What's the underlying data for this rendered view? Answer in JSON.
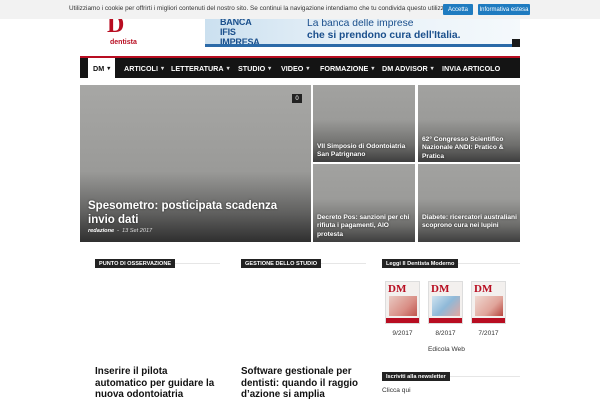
{
  "cookie": {
    "text": "Utilizziamo i cookie per offrirti i migliori contenuti del nostro sito. Se continui la navigazione intendiamo che tu condivida questo utilizzo.",
    "accept_label": "Accetta",
    "info_label": "Informativa estesa"
  },
  "header": {
    "logo_letter": "D",
    "logo_word": "dentista",
    "banner": {
      "brand_line1": "BANCA IFIS",
      "brand_line2": "IMPRESA",
      "line1": "La banca delle imprese",
      "line2": "che si prendono cura dell'Italia."
    }
  },
  "nav": {
    "items": [
      {
        "label": "DM",
        "chevron": "▾"
      },
      {
        "label": "ARTICOLI",
        "chevron": "▾"
      },
      {
        "label": "LETTERATURA",
        "chevron": "▾"
      },
      {
        "label": "STUDIO",
        "chevron": "▾"
      },
      {
        "label": "VIDEO",
        "chevron": "▾"
      },
      {
        "label": "FORMAZIONE",
        "chevron": "▾"
      },
      {
        "label": "DM ADVISOR",
        "chevron": "▾"
      },
      {
        "label": "INVIA ARTICOLO",
        "chevron": ""
      }
    ]
  },
  "hero": {
    "main": {
      "title": "Spesometro: posticipata scadenza invio dati",
      "author": "redazione",
      "separator": "-",
      "date": "13 Set 2017",
      "comments": "0"
    },
    "tiles": [
      {
        "title": "VII Simposio di Odontoiatria San Patrignano"
      },
      {
        "title": "62° Congresso Scientifico Nazionale ANDI: Pratico & Pratica"
      },
      {
        "title": "Decreto Pos: sanzioni per chi rifiuta i pagamenti, AIO protesta"
      },
      {
        "title": "Diabete: ricercatori australiani scoprono cura nei lupini"
      }
    ]
  },
  "columns": [
    {
      "category": "PUNTO DI OSSERVAZIONE",
      "title": "Inserire il pilota automatico per guidare la nuova odontoiatria"
    },
    {
      "category": "GESTIONE DELLO STUDIO",
      "title": "Software gestionale per dentisti: quando il raggio d’azione si amplia"
    }
  ],
  "sidebar": {
    "magazines_heading": "Leggi Il Dentista Moderno",
    "magazines": [
      {
        "logo": "DM",
        "date": "9/2017"
      },
      {
        "logo": "DM",
        "date": "8/2017"
      },
      {
        "logo": "DM",
        "date": "7/2017"
      }
    ],
    "edicola_label": "Edicola Web",
    "newsletter_heading": "Iscriviti alla newsletter",
    "newsletter_text": "Clicca qui"
  },
  "colors": {
    "brand_red": "#b80d21",
    "nav_bg": "#141414",
    "cookie_button": "#1f7bc0"
  }
}
